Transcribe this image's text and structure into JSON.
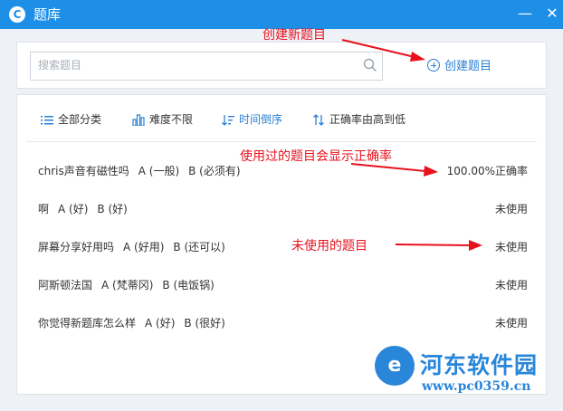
{
  "window": {
    "title": "题库",
    "minimize": "—",
    "close": "✕"
  },
  "search": {
    "placeholder": "搜索题目",
    "value": ""
  },
  "create_button": {
    "label": "创建题目"
  },
  "filters": [
    {
      "label": "全部分类",
      "icon": "list-icon"
    },
    {
      "label": "难度不限",
      "icon": "bar-chart-icon"
    },
    {
      "label": "时间倒序",
      "icon": "sort-time-icon",
      "active": true
    },
    {
      "label": "正确率由高到低",
      "icon": "sort-arrows-icon"
    }
  ],
  "questions": [
    {
      "text": "chris声音有磁性吗",
      "options": [
        "A (一般)",
        "B (必须有)"
      ],
      "status": "100.00%正确率"
    },
    {
      "text": "啊",
      "options": [
        "A (好)",
        "B (好)"
      ],
      "status": "未使用"
    },
    {
      "text": "屏幕分享好用吗",
      "options": [
        "A (好用)",
        "B (还可以)"
      ],
      "status": "未使用"
    },
    {
      "text": "阿斯顿法国",
      "options": [
        "A (梵蒂冈)",
        "B (电饭锅)"
      ],
      "status": "未使用"
    },
    {
      "text": "你觉得新题库怎么样",
      "options": [
        "A (好)",
        "B (很好)"
      ],
      "status": "未使用"
    }
  ],
  "annotations": {
    "create": "创建新题目",
    "used": "使用过的题目会显示正确率",
    "unused": "未使用的题目",
    "arrow_color": "#e8121d"
  },
  "watermark": {
    "logo_glyph": "e",
    "title": "河东软件园",
    "url": "www.pc0359.cn"
  },
  "colors": {
    "titlebar": "#1e8fe6",
    "accent": "#2a7fd4"
  }
}
